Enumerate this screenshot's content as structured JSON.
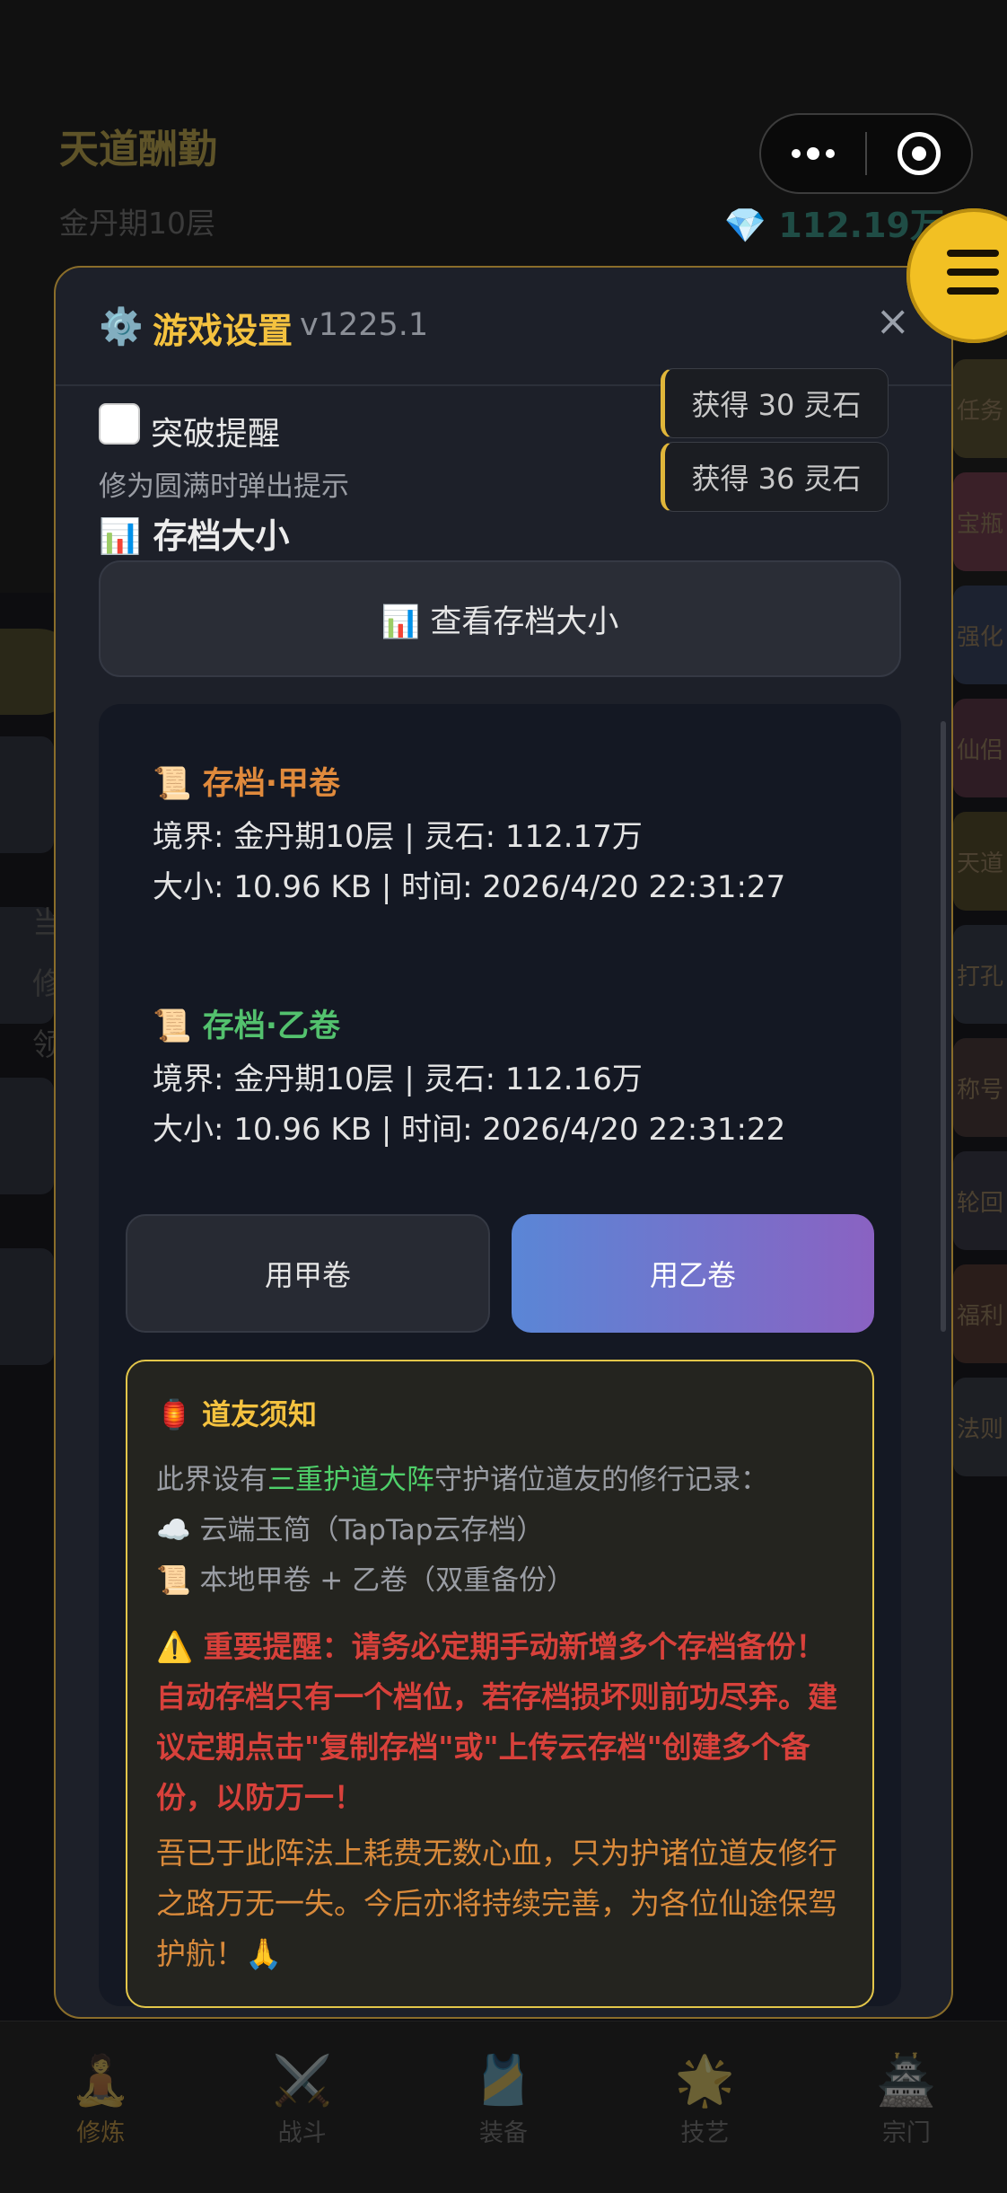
{
  "background": {
    "title": "天道酬勤",
    "realm": "金丹期10层",
    "stones": "💎 112.19万",
    "side_buttons": [
      "任务",
      "宝瓶",
      "强化",
      "仙侣",
      "天道",
      "打孔",
      "称号",
      "轮回",
      "福利",
      "法则"
    ],
    "left_text": [
      "当",
      "修",
      "领"
    ],
    "nav": [
      {
        "icon": "🧘",
        "label": "修炼"
      },
      {
        "icon": "⚔️",
        "label": "战斗"
      },
      {
        "icon": "🎽",
        "label": "装备"
      },
      {
        "icon": "🌟",
        "label": "技艺"
      },
      {
        "icon": "🏯",
        "label": "宗门"
      }
    ]
  },
  "modal": {
    "gear": "⚙️",
    "title": "游戏设置",
    "version": "v1225.1",
    "close": "×",
    "toasts": [
      "获得 30 灵石",
      "获得 36 灵石"
    ],
    "breakthrough": {
      "label": "突破提醒",
      "desc": "修为圆满时弹出提示",
      "checked": false
    },
    "section_title": "📊 存档大小",
    "view_button": "📊 查看存档大小",
    "saves": [
      {
        "name": "📜 存档·甲卷",
        "color": "#e08a3c",
        "line1": "境界: 金丹期10层 | 灵石: 112.17万",
        "line2": "大小: 10.96 KB | 时间: 2026/4/20 22:31:27"
      },
      {
        "name": "📜 存档·乙卷",
        "color": "#53c16e",
        "line1": "境界: 金丹期10层 | 灵石: 112.16万",
        "line2": "大小: 10.96 KB | 时间: 2026/4/20 22:31:22"
      }
    ],
    "use_a": "用甲卷",
    "use_b": "用乙卷",
    "notice": {
      "title": "🏮 道友须知",
      "intro_pre": "此界设有",
      "intro_hl": "三重护道大阵",
      "intro_post": "守护诸位道友的修行记录：",
      "item1": "☁️ 云端玉简（TapTap云存档）",
      "item2": "📜 本地甲卷 + 乙卷（双重备份）",
      "warning": "⚠️ 重要提醒：请务必定期手动新增多个存档备份！自动存档只有一个档位，若存档损坏则前功尽弃。建议定期点击\"复制存档\"或\"上传云存档\"创建多个备份，以防万一！",
      "blessing": "吾已于此阵法上耗费无数心血，只为护诸位道友修行之路万无一失。今后亦将持续完善，为各位仙途保驾护航！🙏"
    }
  }
}
